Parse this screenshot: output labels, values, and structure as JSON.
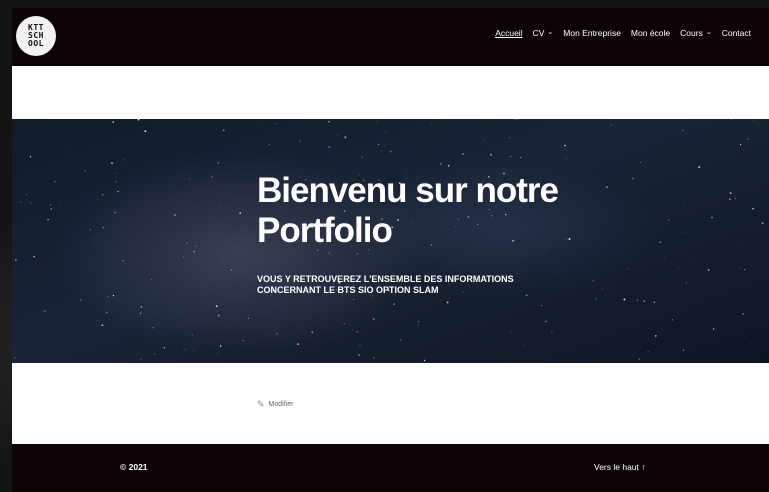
{
  "logo": {
    "text": "KTT\nSCH\nOOL"
  },
  "nav": {
    "items": [
      {
        "label": "Accueil",
        "active": true,
        "dropdown": false
      },
      {
        "label": "CV",
        "active": false,
        "dropdown": true
      },
      {
        "label": "Mon Entreprise",
        "active": false,
        "dropdown": false
      },
      {
        "label": "Mon école",
        "active": false,
        "dropdown": false
      },
      {
        "label": "Cours",
        "active": false,
        "dropdown": true
      },
      {
        "label": "Contact",
        "active": false,
        "dropdown": false
      }
    ],
    "chevron": "⌄"
  },
  "hero": {
    "title": "Bienvenu sur notre Portfolio",
    "subtitle": "VOUS Y RETROUVEREZ L'ENSEMBLE DES INFORMATIONS CONCERNANT LE BTS SIO OPTION SLAM"
  },
  "edit": {
    "icon": "edit-icon",
    "label": "Modifier"
  },
  "footer": {
    "copyright": "© 2021",
    "back_to_top": "Vers le haut ↑"
  },
  "colors": {
    "header_bg": "#0c0304",
    "page_bg": "#ffffff",
    "text_light": "#ffffff"
  }
}
